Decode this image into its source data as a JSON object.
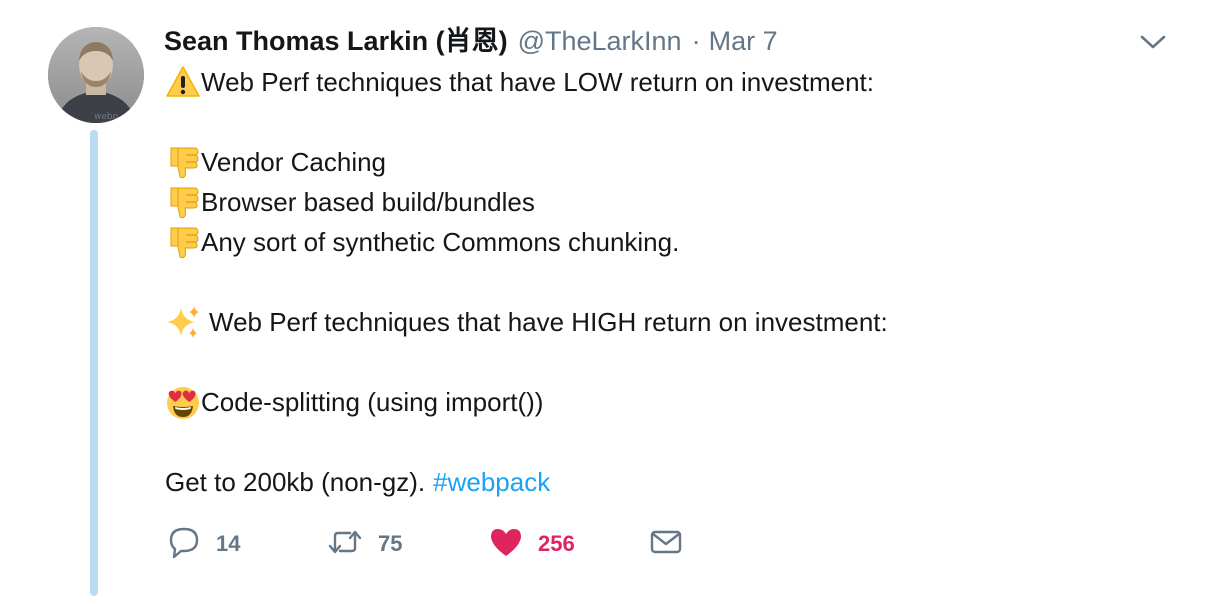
{
  "author": {
    "name": "Sean Thomas Larkin (肖恩)",
    "handle": "@TheLarkInn",
    "separator": "·",
    "date": "Mar 7"
  },
  "tweet": {
    "line1": "Web Perf techniques that have LOW return on investment:",
    "low_items": [
      "Vendor Caching",
      "Browser based build/bundles",
      "Any sort of synthetic Commons chunking."
    ],
    "line_high": "Web Perf techniques that have HIGH return on investment:",
    "high_item": "Code-splitting (using import())",
    "closing_text": "Get to 200kb (non-gz).",
    "hashtag": "#webpack"
  },
  "icons": {
    "warning": "warning-emoji-icon",
    "thumbs_down": "thumbs-down-emoji-icon",
    "sparkles": "sparkles-emoji-icon",
    "heart_eyes": "heart-eyes-emoji-icon",
    "reply": "reply-icon",
    "retweet": "retweet-icon",
    "like": "heart-icon",
    "dm": "envelope-icon",
    "caret": "chevron-down-icon"
  },
  "actions": {
    "replies": "14",
    "retweets": "75",
    "likes": "256"
  },
  "colors": {
    "text": "#14171a",
    "muted": "#657786",
    "link": "#1da1f2",
    "like": "#e0245e",
    "thread_line": "#b9dcf2"
  }
}
